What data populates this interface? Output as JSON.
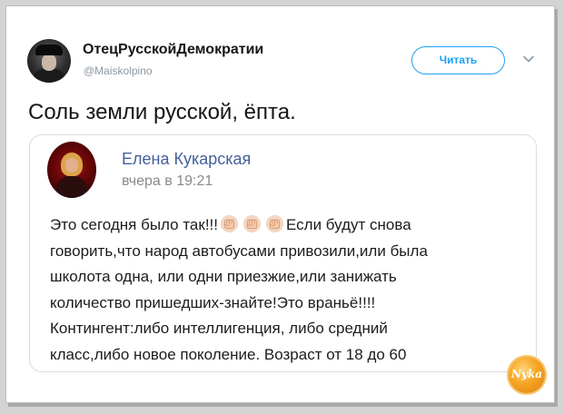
{
  "tweet": {
    "author_name": "ОтецРусскойДемократии",
    "author_handle": "@Maiskolpino",
    "follow_label": "Читать",
    "text": "Соль земли русской, ёпта."
  },
  "quote": {
    "author_name": "Елена Кукарская",
    "timestamp": "вчера в 19:21",
    "line1_a": "Это сегодня было так!!!",
    "line1_b": "Если будут снова",
    "line2": "говорить,что народ автобусами привозили,или была",
    "line3": "школота одна, или одни приезжие,или занижать",
    "line4": "количество пришедших-знайте!Это враньё!!!!",
    "line5": "Контингент:либо интеллигенция, либо средний",
    "line6": "класс,либо новое поколение. Возраст от 18 до 60"
  },
  "icons": {
    "fist": "raised-fist-icon",
    "chevron": "chevron-down-icon"
  },
  "watermark": {
    "text": "Nyka"
  },
  "colors": {
    "accent": "#1da1f2",
    "link_name": "#44609c",
    "watermark": "#f5a623"
  }
}
